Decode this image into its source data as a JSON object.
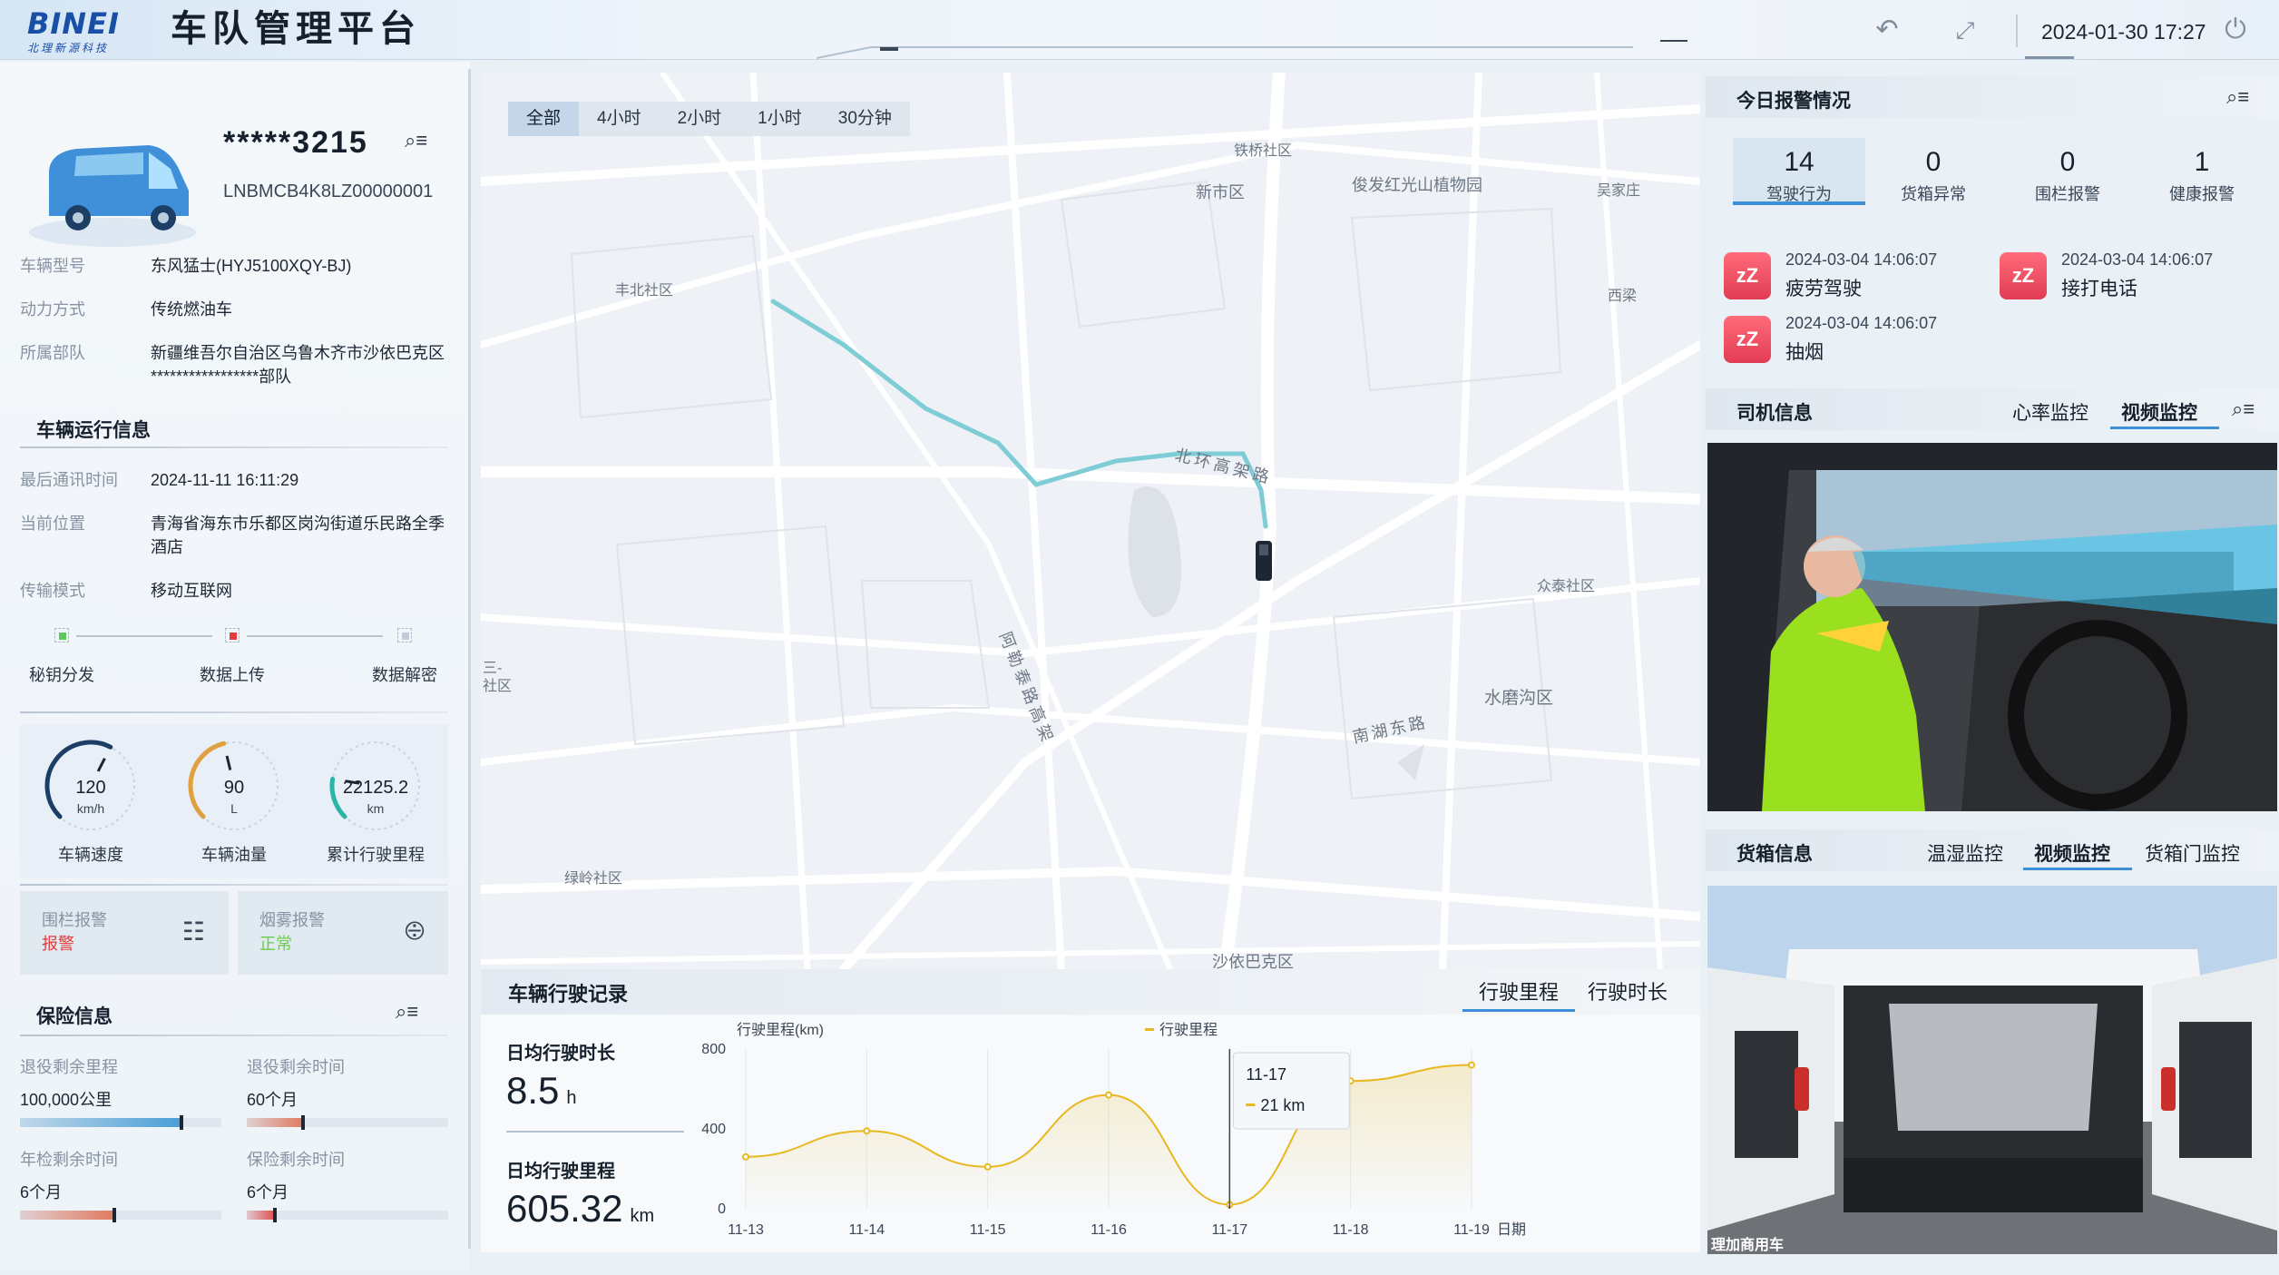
{
  "header": {
    "logo_text": "BINEI",
    "logo_sub": "北理新源科技",
    "title": "车队管理平台",
    "datetime": "2024-01-30 17:27",
    "icons": [
      "undo-icon",
      "fullscreen-icon",
      "power-icon"
    ]
  },
  "vehicle": {
    "plate": "*****3215",
    "vin": "LNBMCB4K8LZ00000001",
    "fields": [
      {
        "k": "车辆型号",
        "v": "东风猛士(HYJ5100XQY-BJ)"
      },
      {
        "k": "动力方式",
        "v": "传统燃油车"
      },
      {
        "k": "所属部队",
        "v": "新疆维吾尔自治区乌鲁木齐市沙依巴克区*****************部队"
      }
    ]
  },
  "run_info": {
    "title": "车辆运行信息",
    "fields": [
      {
        "k": "最后通讯时间",
        "v": "2024-11-11 16:11:29"
      },
      {
        "k": "当前位置",
        "v": "青海省海东市乐都区岗沟街道乐民路全季酒店"
      },
      {
        "k": "传输模式",
        "v": "移动互联网"
      }
    ],
    "steps": [
      "秘钥分发",
      "数据上传",
      "数据解密"
    ]
  },
  "gauges": [
    {
      "label": "车辆速度",
      "value": "120",
      "unit": "km/h",
      "level": 0.6
    },
    {
      "label": "车辆油量",
      "value": "90",
      "unit": "L",
      "level": 0.45
    },
    {
      "label": "累计行驶里程",
      "value": "22125.2",
      "unit": "km",
      "level": 0.2
    }
  ],
  "alarms_small": [
    {
      "k": "围栏报警",
      "v": "报警",
      "color": "#e23c3c",
      "icon": "fence-icon"
    },
    {
      "k": "烟雾报警",
      "v": "正常",
      "color": "#6ccf4c",
      "icon": "smoke-detector-icon"
    }
  ],
  "insurance": {
    "title": "保险信息",
    "items": [
      {
        "k": "退役剩余里程",
        "v": "100,000公里",
        "level": 0.8,
        "color": "#4a9fd6"
      },
      {
        "k": "退役剩余时间",
        "v": "60个月",
        "level": 0.28,
        "color": "#e07a5f"
      },
      {
        "k": "年检剩余时间",
        "v": "6个月",
        "level": 0.47,
        "color": "#e07a5f"
      },
      {
        "k": "保险剩余时间",
        "v": "6个月",
        "level": 0.14,
        "color": "#e05050"
      }
    ]
  },
  "map": {
    "tabs": [
      "全部",
      "4小时",
      "2小时",
      "1小时",
      "30分钟"
    ],
    "active_tab": 0,
    "labels": [
      "铁桥社区",
      "新市区",
      "俊发红光山植物园",
      "吴家庄",
      "丰北社区",
      "西梁",
      "北环高架路",
      "阿勒泰路高架",
      "众泰社区",
      "水磨沟区",
      "南湖东路",
      "绿岭社区",
      "沙依巴克区",
      "社区",
      "三-"
    ]
  },
  "record": {
    "title": "车辆行驶记录",
    "tabs": [
      "行驶里程",
      "行驶时长"
    ],
    "active_tab": 0,
    "avg_duration_label": "日均行驶时长",
    "avg_duration": "8.5",
    "avg_duration_unit": "h",
    "avg_mileage_label": "日均行驶里程",
    "avg_mileage": "605.32",
    "avg_mileage_unit": "km"
  },
  "chart_data": {
    "type": "area",
    "ylabel": "行驶里程(km)",
    "xlabel": "日期",
    "series_name": "行驶里程",
    "categories": [
      "11-13",
      "11-14",
      "11-15",
      "11-16",
      "11-17",
      "11-18",
      "11-19"
    ],
    "values": [
      260,
      390,
      210,
      570,
      21,
      640,
      720
    ],
    "ylim": [
      0,
      800
    ],
    "yticks": [
      0,
      400,
      800
    ],
    "tooltip": {
      "category": "11-17",
      "text": "21 km"
    },
    "color": "#e8b820"
  },
  "alarm_today": {
    "title": "今日报警情况",
    "counts": [
      {
        "n": "14",
        "l": "驾驶行为"
      },
      {
        "n": "0",
        "l": "货箱异常"
      },
      {
        "n": "0",
        "l": "围栏报警"
      },
      {
        "n": "1",
        "l": "健康报警"
      }
    ],
    "list": [
      {
        "time": "2024-03-04 14:06:07",
        "type": "疲劳驾驶"
      },
      {
        "time": "2024-03-04 14:06:07",
        "type": "接打电话"
      },
      {
        "time": "2024-03-04 14:06:07",
        "type": "抽烟"
      }
    ]
  },
  "driver": {
    "title": "司机信息",
    "tabs": [
      "心率监控",
      "视频监控"
    ],
    "active_tab": 1
  },
  "cargo": {
    "title": "货箱信息",
    "tabs": [
      "温湿监控",
      "视频监控",
      "货箱门监控"
    ],
    "active_tab": 1,
    "watermark": "理加商用车"
  }
}
